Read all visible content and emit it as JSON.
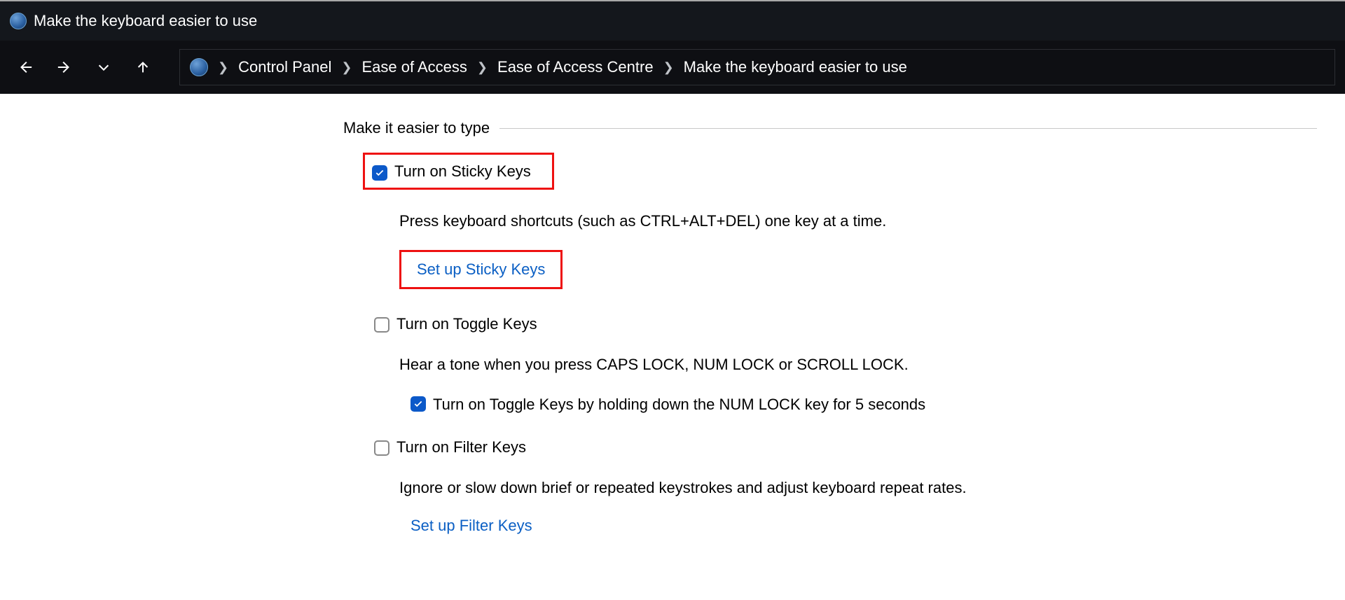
{
  "window": {
    "title": "Make the keyboard easier to use"
  },
  "breadcrumb": {
    "items": [
      "Control Panel",
      "Ease of Access",
      "Ease of Access Centre",
      "Make the keyboard easier to use"
    ]
  },
  "section": {
    "heading": "Make it easier to type",
    "sticky": {
      "label": "Turn on Sticky Keys",
      "desc": "Press keyboard shortcuts (such as CTRL+ALT+DEL) one key at a time.",
      "link": "Set up Sticky Keys"
    },
    "toggle": {
      "label": "Turn on Toggle Keys",
      "desc": "Hear a tone when you press CAPS LOCK, NUM LOCK or SCROLL LOCK.",
      "numlock_label": "Turn on Toggle Keys by holding down the NUM LOCK key for 5 seconds"
    },
    "filter": {
      "label": "Turn on Filter Keys",
      "desc": "Ignore or slow down brief or repeated keystrokes and adjust keyboard repeat rates.",
      "link": "Set up Filter Keys"
    }
  }
}
